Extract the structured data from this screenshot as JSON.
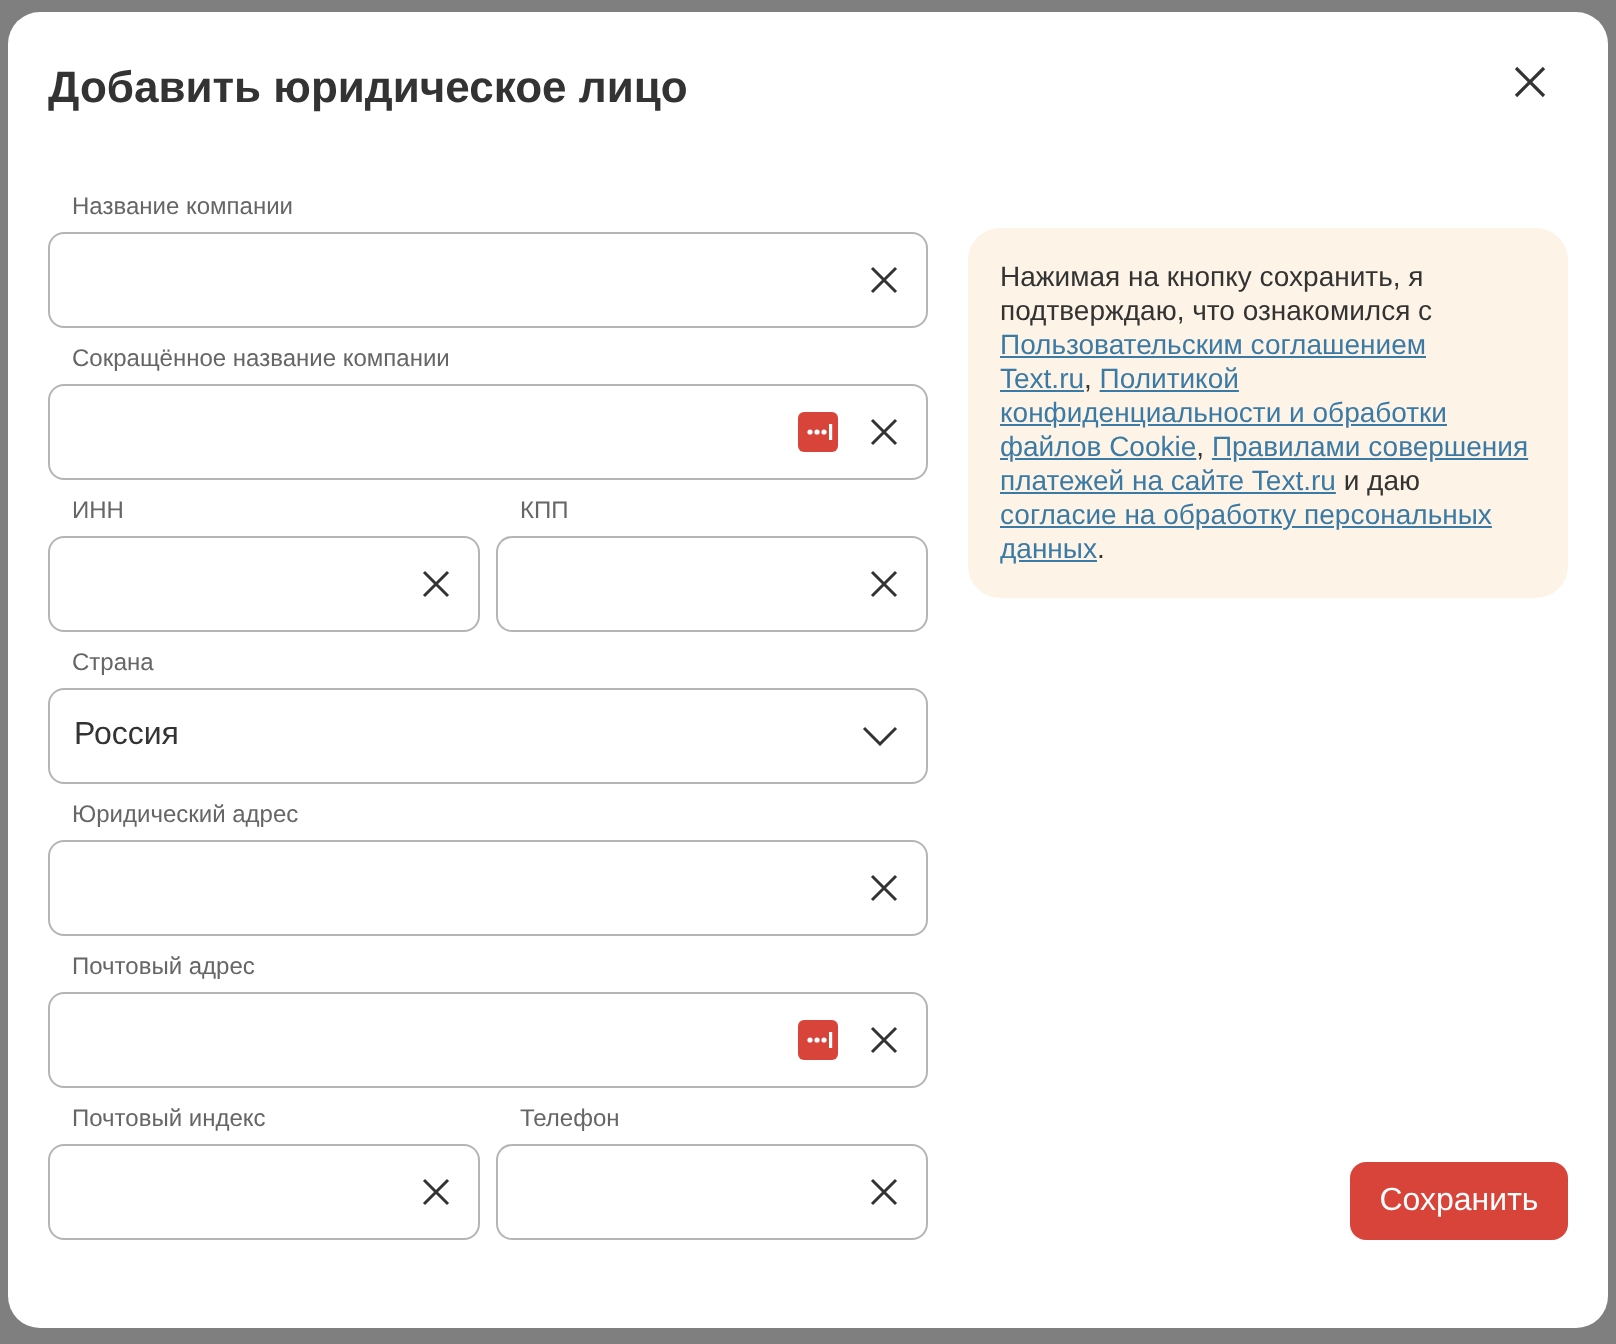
{
  "dialog": {
    "title": "Добавить юридическое лицо"
  },
  "form": {
    "rows": [
      [
        {
          "kind": "text",
          "label": "Название компании",
          "clearable": true
        }
      ],
      [
        {
          "kind": "text",
          "label": "Сокращённое название компании",
          "clearable": true,
          "autofill_icon": true
        }
      ],
      [
        {
          "kind": "text",
          "label": "ИНН",
          "clearable": true
        },
        {
          "kind": "text",
          "label": "КПП",
          "clearable": true
        }
      ],
      [
        {
          "kind": "select",
          "label": "Страна",
          "value": "Россия"
        }
      ],
      [
        {
          "kind": "text",
          "label": "Юридический адрес",
          "clearable": true
        }
      ],
      [
        {
          "kind": "text",
          "label": "Почтовый адрес",
          "clearable": true,
          "autofill_icon": true
        }
      ],
      [
        {
          "kind": "text",
          "label": "Почтовый индекс",
          "clearable": true
        },
        {
          "kind": "text",
          "label": "Телефон",
          "clearable": true
        }
      ]
    ]
  },
  "consent": {
    "parts": [
      {
        "kind": "text",
        "text": "Нажимая на кнопку сохранить, я подтверждаю, что ознакомился с "
      },
      {
        "kind": "link",
        "text": "Пользовательским соглашением"
      },
      {
        "kind": "link",
        "text": "Text.ru"
      },
      {
        "kind": "text",
        "text": ", "
      },
      {
        "kind": "link",
        "text": "Политикой"
      },
      {
        "kind": "link",
        "text": "конфиденциальности и обработки"
      },
      {
        "kind": "link",
        "text": "файлов Cookie"
      },
      {
        "kind": "text",
        "text": ", "
      },
      {
        "kind": "link",
        "text": "Правилами совершения"
      },
      {
        "kind": "link",
        "text": "платежей на сайте Text.ru"
      },
      {
        "kind": "text",
        "text": " и даю "
      },
      {
        "kind": "link",
        "text": "согласие на обработку персональных"
      },
      {
        "kind": "link",
        "text": "данных"
      },
      {
        "kind": "text",
        "text": "."
      }
    ]
  },
  "save_button": "Сохранить"
}
